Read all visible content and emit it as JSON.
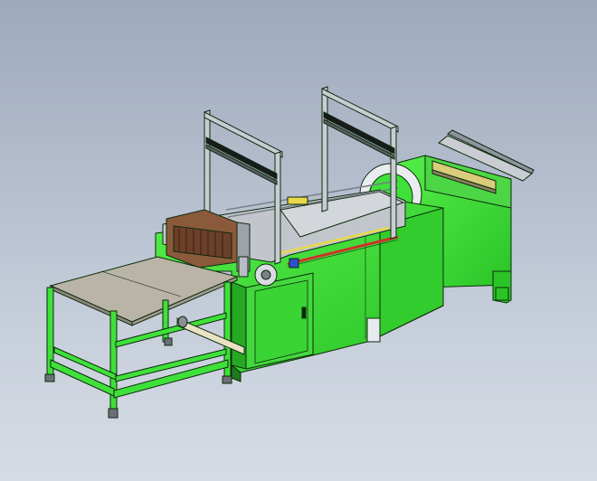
{
  "viewport": {
    "background_top": "#9ea9bd",
    "background_bottom": "#d6dce4"
  },
  "model": {
    "subject": "machine-3d-render",
    "colors": {
      "frame_green": "#3fe03a",
      "frame_dark": "#1f7a1c",
      "edge": "#0d2a0c",
      "table_top": "#b9b4a6",
      "rail_grey": "#b8bcc4",
      "cutter_brown": "#8a5a3a",
      "accent_red": "#d0302a",
      "accent_yellow": "#e8d84a",
      "accent_blue": "#2a4fd0"
    }
  }
}
